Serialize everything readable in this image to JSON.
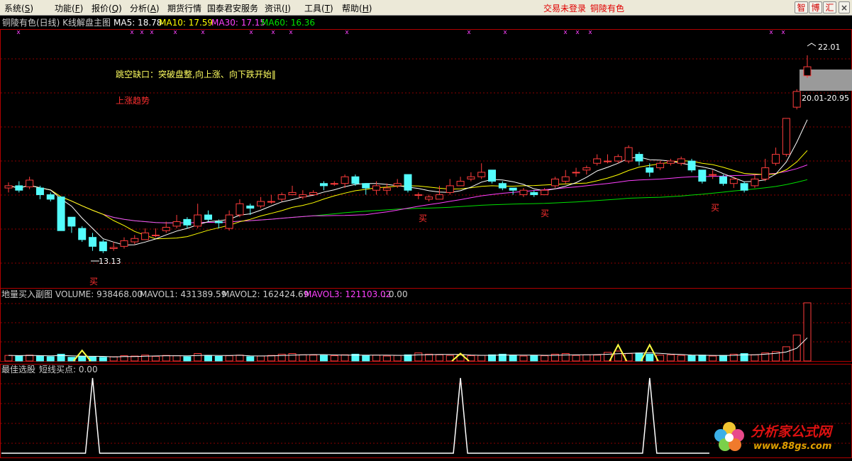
{
  "menu": [
    {
      "label": "系统",
      "accel": "S"
    },
    {
      "label": "功能",
      "accel": "F"
    },
    {
      "label": "报价",
      "accel": "Q"
    },
    {
      "label": "分析",
      "accel": "A"
    },
    {
      "label": "期货行情",
      "accel": ""
    },
    {
      "label": "国泰君安服务",
      "accel": ""
    },
    {
      "label": "资讯",
      "accel": "I"
    },
    {
      "label": "工具",
      "accel": "T"
    },
    {
      "label": "帮助",
      "accel": "H"
    }
  ],
  "status": {
    "login": "交易未登录",
    "stock": "铜陵有色"
  },
  "toolbar": {
    "zhi": "智",
    "bo": "博",
    "hui": "汇"
  },
  "main": {
    "title": "铜陵有色(日线) K线解盘主图",
    "ma": [
      {
        "label": "MA5: 18.78",
        "color": "#ffffff"
      },
      {
        "label": "MA10: 17.59",
        "color": "#ffff00"
      },
      {
        "label": "MA30: 17.15",
        "color": "#ff40ff"
      },
      {
        "label": "MA60: 16.36",
        "color": "#00e000"
      }
    ],
    "annotation": "跳空缺口：突破盘整,向上涨、向下跌开始‖",
    "trend": "上涨趋势",
    "high_label": "22.01",
    "low_label": "13.13",
    "gap_label": "20.01-20.95",
    "buy_label": "买",
    "marker": "x"
  },
  "colors": {
    "up": "#ff3c3c",
    "down": "#54fcfc",
    "grid": "#8b0000",
    "frame": "#b00000"
  },
  "chart_data": [
    {
      "type": "candlestick",
      "title": "铜陵有色(日线) K线解盘主图",
      "ylim": [
        12.5,
        22.8
      ],
      "series": [
        {
          "name": "MA5"
        },
        {
          "name": "MA10"
        },
        {
          "name": "MA30"
        },
        {
          "name": "MA60"
        }
      ],
      "candles": [
        [
          16.1,
          16.2,
          16.35,
          15.9
        ],
        [
          16.2,
          16.0,
          16.4,
          15.9
        ],
        [
          16.15,
          16.45,
          16.6,
          16.05
        ],
        [
          16.1,
          15.8,
          16.2,
          15.6
        ],
        [
          15.8,
          15.6,
          15.9,
          15.5
        ],
        [
          15.7,
          14.2,
          15.7,
          14.2
        ],
        [
          14.8,
          14.4,
          14.8,
          14.1
        ],
        [
          14.3,
          13.8,
          14.4,
          13.7
        ],
        [
          13.9,
          13.5,
          14.1,
          13.3
        ],
        [
          13.7,
          13.3,
          13.8,
          13.2
        ],
        [
          13.4,
          13.45,
          13.7,
          13.3
        ],
        [
          13.5,
          13.75,
          13.9,
          13.4
        ],
        [
          13.7,
          13.85,
          14.0,
          13.6
        ],
        [
          13.8,
          14.1,
          14.3,
          13.8
        ],
        [
          14.0,
          14.0,
          14.3,
          13.9
        ],
        [
          14.2,
          14.35,
          14.6,
          14.1
        ],
        [
          14.4,
          14.6,
          14.9,
          14.3
        ],
        [
          14.7,
          14.45,
          14.8,
          14.3
        ],
        [
          14.4,
          14.9,
          15.4,
          14.3
        ],
        [
          14.9,
          14.7,
          15.1,
          14.6
        ],
        [
          14.6,
          14.55,
          14.7,
          14.3
        ],
        [
          14.3,
          14.9,
          15.1,
          14.2
        ],
        [
          14.9,
          15.4,
          15.6,
          14.8
        ],
        [
          15.3,
          15.2,
          15.4,
          14.9
        ],
        [
          15.3,
          15.5,
          15.7,
          15.2
        ],
        [
          15.5,
          15.5,
          15.8,
          15.4
        ],
        [
          15.6,
          15.8,
          15.9,
          15.5
        ],
        [
          15.8,
          15.9,
          16.2,
          15.8
        ],
        [
          15.7,
          15.8,
          16.0,
          15.6
        ],
        [
          15.8,
          15.9,
          16.0,
          15.8
        ],
        [
          16.3,
          16.2,
          16.4,
          16.0
        ],
        [
          16.3,
          16.3,
          16.4,
          16.2
        ],
        [
          16.3,
          16.6,
          16.7,
          16.1
        ],
        [
          16.6,
          16.3,
          16.7,
          16.2
        ],
        [
          16.3,
          16.1,
          16.3,
          15.8
        ],
        [
          16.0,
          16.2,
          16.4,
          15.8
        ],
        [
          16.0,
          16.1,
          16.3,
          15.8
        ],
        [
          16.2,
          16.3,
          16.5,
          16.1
        ],
        [
          16.7,
          16.0,
          16.7,
          15.9
        ],
        [
          15.8,
          15.8,
          15.9,
          15.6
        ],
        [
          15.6,
          15.7,
          15.8,
          15.5
        ],
        [
          15.6,
          15.8,
          16.2,
          15.6
        ],
        [
          15.9,
          16.2,
          16.5,
          15.8
        ],
        [
          16.2,
          16.4,
          16.6,
          16.2
        ],
        [
          16.5,
          16.6,
          16.8,
          16.4
        ],
        [
          16.6,
          16.8,
          17.2,
          16.5
        ],
        [
          16.9,
          16.4,
          16.9,
          16.3
        ],
        [
          16.3,
          16.1,
          16.4,
          16.0
        ],
        [
          16.1,
          16.0,
          16.1,
          15.8
        ],
        [
          15.8,
          16.0,
          16.1,
          15.7
        ],
        [
          15.9,
          15.8,
          16.0,
          15.7
        ],
        [
          15.8,
          16.0,
          16.1,
          15.8
        ],
        [
          16.2,
          16.5,
          16.6,
          16.1
        ],
        [
          16.4,
          16.6,
          16.9,
          16.3
        ],
        [
          16.8,
          16.8,
          17.0,
          16.6
        ],
        [
          16.9,
          17.0,
          17.1,
          16.7
        ],
        [
          17.2,
          17.4,
          17.6,
          17.1
        ],
        [
          17.3,
          17.3,
          17.6,
          17.2
        ],
        [
          17.3,
          17.5,
          17.6,
          17.2
        ],
        [
          17.3,
          17.9,
          18.0,
          17.2
        ],
        [
          17.6,
          17.3,
          17.7,
          17.1
        ],
        [
          17.0,
          16.8,
          17.2,
          16.6
        ],
        [
          17.0,
          17.2,
          17.3,
          16.9
        ],
        [
          17.2,
          17.3,
          17.4,
          17.1
        ],
        [
          17.2,
          17.4,
          17.5,
          17.1
        ],
        [
          17.3,
          16.9,
          17.4,
          16.8
        ],
        [
          16.9,
          16.4,
          16.9,
          16.3
        ],
        [
          16.7,
          16.7,
          16.9,
          16.5
        ],
        [
          16.6,
          16.3,
          16.7,
          16.2
        ],
        [
          16.3,
          16.5,
          16.6,
          16.1
        ],
        [
          16.3,
          16.0,
          16.4,
          15.9
        ],
        [
          16.2,
          16.5,
          16.7,
          16.1
        ],
        [
          16.5,
          17.0,
          17.4,
          16.4
        ],
        [
          17.2,
          17.6,
          17.9,
          17.1
        ],
        [
          17.6,
          19.2,
          19.2,
          17.5
        ],
        [
          19.7,
          20.4,
          20.5,
          19.6
        ],
        [
          21.1,
          21.5,
          22.01,
          21.0
        ]
      ]
    },
    {
      "type": "bar",
      "title": "地量买入副图",
      "series": [
        {
          "name": "VOLUME"
        },
        {
          "name": "MAVOL1"
        },
        {
          "name": "MAVOL2"
        },
        {
          "name": "MAVOL3"
        }
      ],
      "labels": [
        "VOLUME: 938468.00",
        "MAVOL1: 431389.59",
        "MAVOL2: 162424.69",
        "MAVOL3: 121103.02",
        ": 0.00"
      ],
      "values": [
        90,
        85,
        95,
        80,
        70,
        110,
        60,
        75,
        65,
        60,
        70,
        85,
        80,
        95,
        75,
        90,
        85,
        70,
        120,
        90,
        75,
        85,
        95,
        70,
        80,
        90,
        110,
        120,
        100,
        95,
        90,
        85,
        100,
        110,
        85,
        95,
        80,
        90,
        100,
        130,
        110,
        100,
        90,
        95,
        85,
        90,
        100,
        110,
        95,
        80,
        90,
        85,
        110,
        120,
        90,
        100,
        95,
        140,
        160,
        120,
        130,
        110,
        95,
        100,
        90,
        85,
        95,
        80,
        90,
        110,
        120,
        100,
        130,
        150,
        230,
        420,
        938
      ],
      "spikes": [
        [
          7,
          170
        ],
        [
          43,
          120
        ],
        [
          58,
          260
        ],
        [
          61,
          260
        ]
      ]
    },
    {
      "type": "line",
      "title": "最佳选股",
      "labels": [
        "短线买点: 0.00"
      ],
      "spikes": [
        8,
        43,
        61
      ]
    }
  ]
}
